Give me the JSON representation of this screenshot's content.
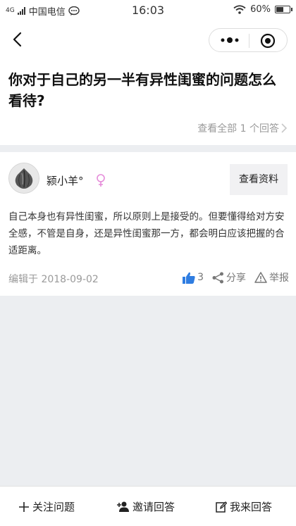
{
  "status_bar": {
    "signal_label": "4G",
    "carrier": "中国电信",
    "time": "16:03",
    "battery": "60%",
    "battery_level": 0.6
  },
  "nav": {
    "back_icon": "chevron-left-icon",
    "more_icon": "more-dots-icon",
    "close_icon": "target-icon"
  },
  "question": {
    "title": "你对于自己的另一半有异性闺蜜的问题怎么看待?",
    "view_all": "查看全部 1 个回答"
  },
  "answer": {
    "username": "颍小羊°",
    "gender_icon": "female-symbol-icon",
    "profile_button": "查看资料",
    "content": "自己本身也有异性闺蜜，所以原则上是接受的。但要懂得给对方安全感，不管是自身，还是异性闺蜜那一方，都会明白应该把握的合适距离。",
    "edited": "编辑于 2018-09-02",
    "likes": "3",
    "share": "分享",
    "report": "举报"
  },
  "bottom_bar": {
    "follow": "关注问题",
    "invite": "邀请回答",
    "answer": "我来回答"
  },
  "colors": {
    "accent_blue": "#2f7de1",
    "female_pink": "#e58bd9",
    "muted_text": "#9a9a9a",
    "page_bg": "#eceef1"
  }
}
